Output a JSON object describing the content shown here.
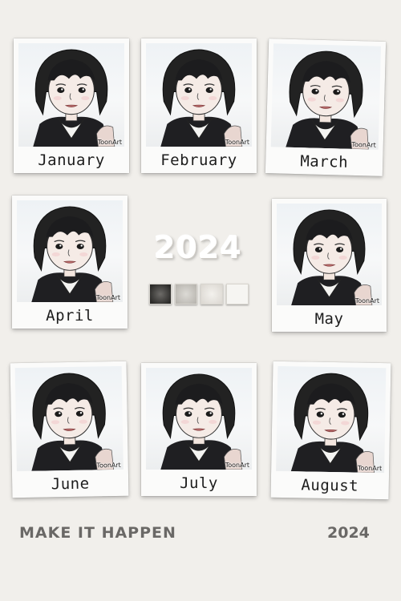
{
  "calendar": {
    "year": "2024",
    "tagline": "MAKE IT HAPPEN",
    "footer_year": "2024",
    "photo_watermark": "ToonArt",
    "months": [
      {
        "label": "January"
      },
      {
        "label": "February"
      },
      {
        "label": "March"
      },
      {
        "label": "April"
      },
      {
        "label": "May"
      },
      {
        "label": "June"
      },
      {
        "label": "July"
      },
      {
        "label": "August"
      }
    ],
    "swatches": [
      "#3a3937",
      "#cfcdc8",
      "#ebe8e3",
      "#f6f5f2"
    ]
  }
}
